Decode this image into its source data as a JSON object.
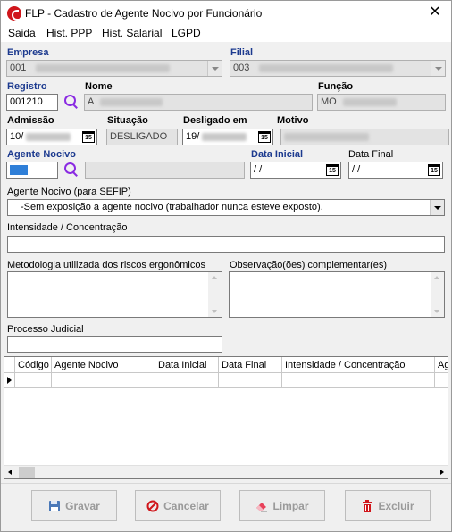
{
  "window": {
    "title": "FLP - Cadastro de Agente Nocivo por Funcionário"
  },
  "menu": [
    "Saida",
    "Hist. PPP",
    "Hist. Salarial",
    "LGPD"
  ],
  "empresa": {
    "label": "Empresa",
    "value": "001"
  },
  "filial": {
    "label": "Filial",
    "value": "003"
  },
  "registro": {
    "label": "Registro",
    "value": "001210"
  },
  "nome": {
    "label": "Nome",
    "value": "A"
  },
  "funcao": {
    "label": "Função",
    "value": "MO"
  },
  "admissao": {
    "label": "Admissão",
    "value": "10/"
  },
  "situacao": {
    "label": "Situação",
    "value": "DESLIGADO"
  },
  "desligado": {
    "label": "Desligado em",
    "value": "19/"
  },
  "motivo": {
    "label": "Motivo",
    "value": ""
  },
  "agente": {
    "label": "Agente Nocivo",
    "value": ""
  },
  "data_inicial": {
    "label": "Data Inicial",
    "value": " /  /"
  },
  "data_final": {
    "label": "Data Final",
    "value": " /  /"
  },
  "sefip": {
    "label": "Agente Nocivo (para SEFIP)",
    "value": "-Sem exposição a agente nocivo (trabalhador nunca esteve exposto)."
  },
  "intensidade": {
    "label": "Intensidade /  Concentração",
    "value": ""
  },
  "metodologia": {
    "label": "Metodologia utilizada dos riscos ergonômicos",
    "value": ""
  },
  "observacao": {
    "label": "Observação(ões) complementar(es)",
    "value": ""
  },
  "processo": {
    "label": "Processo Judicial",
    "value": ""
  },
  "calendar_icon_text": "15",
  "grid": {
    "columns": [
      "Código",
      "Agente Nocivo",
      "Data Inicial",
      "Data Final",
      "Intensidade /  Concentração",
      "Ag"
    ]
  },
  "buttons": {
    "gravar": "Gravar",
    "cancelar": "Cancelar",
    "limpar": "Limpar",
    "excluir": "Excluir"
  },
  "colors": {
    "label_blue": "#1c3a8f",
    "accent": "#d0161b",
    "search": "#8a2be2"
  }
}
